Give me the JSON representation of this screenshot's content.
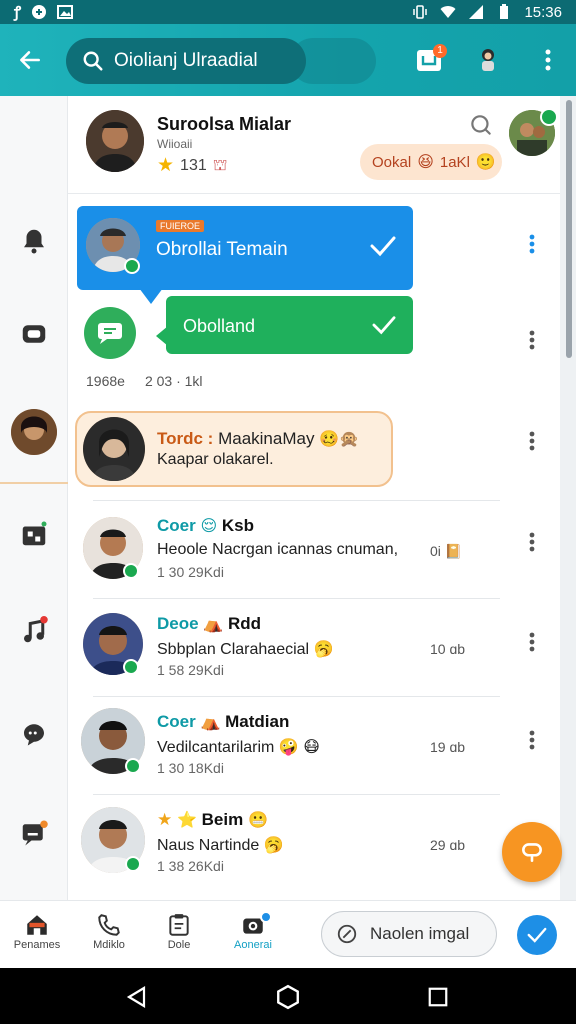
{
  "status_bar": {
    "time": "15:36"
  },
  "app_bar": {
    "search_query": "Oiolianj Ulraadial",
    "notification_badge": "1"
  },
  "header": {
    "name": "Suroolsa Mialar",
    "subtitle": "Wiioaii",
    "rating": "131",
    "bubble_text": "Ookal",
    "bubble_suffix": "1aKl"
  },
  "selected_card": {
    "tag": "FUIEROE",
    "title": "Obrollai Temain"
  },
  "green_card": {
    "label": "Obolland"
  },
  "meta_row": {
    "left": "1968e",
    "right": "2 03 · 1kl"
  },
  "highlight_card": {
    "highlight": "Tordc :",
    "line1": " MaakinaMay",
    "line2": "Kaapar olakarel."
  },
  "chats": [
    {
      "name": "Coer",
      "name_rest": "Ksb",
      "preview": "Heoole Nacrgan icannas cnuman,",
      "time": "1 30 29Kdi",
      "right": "0i"
    },
    {
      "name": "Deoe",
      "name_rest": "Rdd",
      "preview": "Sbbplan Clarahaecial",
      "time": "1 58 29Kdi",
      "right": "10 ɑb"
    },
    {
      "name": "Coer",
      "name_rest": "Matdian",
      "preview": "Vedilcantarilarim",
      "time": "1 30 18Kdi",
      "right": "19 ɑb"
    },
    {
      "name": "",
      "name_rest": "Beim",
      "preview": "Naus Nartinde",
      "time": "1 38 26Kdi",
      "right": "29 ɑb"
    }
  ],
  "bottom_nav": {
    "items": [
      "Penames",
      "Mdiklo",
      "Dole",
      "Aonerai"
    ],
    "compose_label": "Naolen imgal"
  },
  "colors": {
    "teal": "#13a0a8",
    "blue": "#1a8fe8",
    "green": "#1fb05c",
    "orange": "#f79522"
  }
}
